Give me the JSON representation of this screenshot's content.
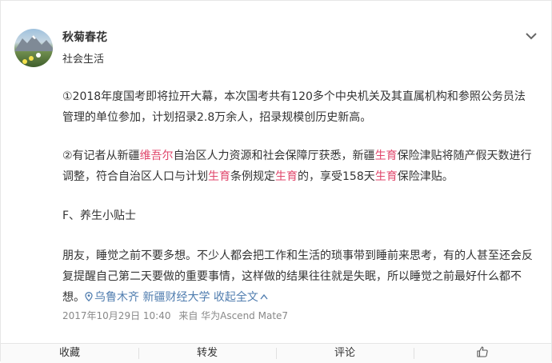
{
  "post": {
    "user_name": "秋菊春花",
    "category": "社会生活",
    "para1": "①2018年度国考即将拉开大幕，本次国考共有120多个中央机关及其直属机构和参照公务员法管理的单位参加，计划招录2.8万余人，招录规模创历史新高。",
    "para2": [
      "②有记者从新疆",
      "维吾尔",
      "自治区人力资源和社会保障厅获悉，新疆",
      "生育",
      "保险津贴将随产假天数进行调整，符合自治区人口与计划",
      "生育",
      "条例规定",
      "生育",
      "的，享受158天",
      "生育",
      "保险津贴。"
    ],
    "heading": "F、养生小贴士",
    "para4": "朋友，睡觉之前不要多想。不少人都会把工作和生活的琐事带到睡前来思考，有的人甚至还会反复提醒自己第二天要做的重要事情，这样做的结果往往就是失眠，所以睡觉之前最好什么都不想。",
    "location_link": "乌鲁木齐 新疆财经大学",
    "collapse_link": "收起全文",
    "timestamp": "2017年10月29日 10:40",
    "source": "来自 华为Ascend Mate7",
    "highlight_color": "#e0466b",
    "link_color": "#507daf"
  },
  "actions": {
    "favorite": "收藏",
    "repost": "转发",
    "comment": "评论",
    "like_icon": "thumbs-up-icon"
  }
}
